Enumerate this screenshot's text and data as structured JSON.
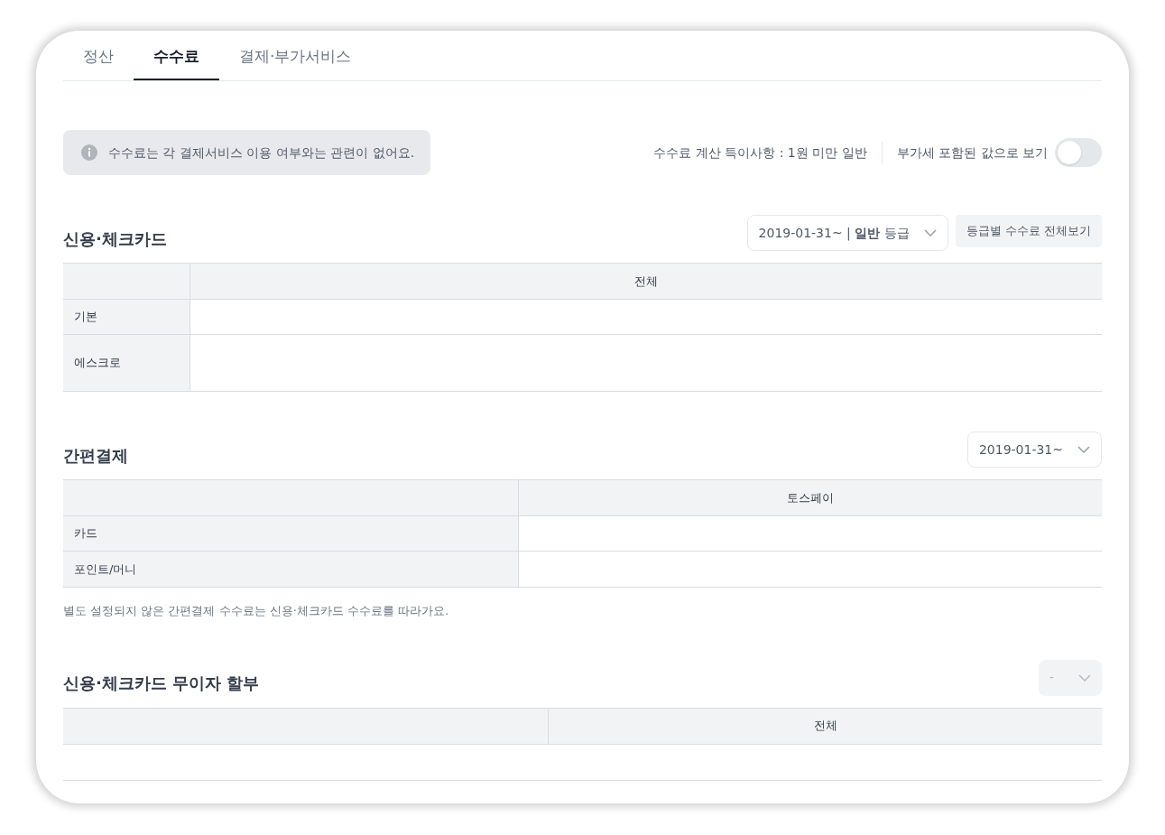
{
  "tabs": [
    {
      "label": "정산",
      "selected": false
    },
    {
      "label": "수수료",
      "selected": true
    },
    {
      "label": "결제·부가서비스",
      "selected": false
    }
  ],
  "info_notice": "수수료는 각 결제서비스 이용 여부와는 관련이 없어요.",
  "fee_note": "수수료 계산 특이사항 : 1원 미만 일반",
  "vat_toggle": {
    "label": "부가세 포함된 값으로 보기",
    "on": false
  },
  "sections": [
    {
      "title": "신용·체크카드",
      "select": {
        "value": "2019-01-31~ | **일반** 등급",
        "disabled": false
      },
      "button": "등급별 수수료 전체보기",
      "columns": [
        "전체"
      ],
      "rows": [
        {
          "label": "기본",
          "tall": false
        },
        {
          "label": "에스크로",
          "tall": true
        }
      ]
    },
    {
      "title": "간편결제",
      "select": {
        "value": "2019-01-31~",
        "disabled": false
      },
      "columns": [
        "토스페이"
      ],
      "rows": [
        {
          "label": "카드",
          "tall": false
        },
        {
          "label": "포인트/머니",
          "tall": false
        }
      ],
      "footnote": "별도 설정되지 않은 간편결제 수수료는 신용·체크카드 수수료를 따라가요."
    },
    {
      "title": "신용·체크카드 무이자 할부",
      "select": {
        "value": "-",
        "disabled": true
      },
      "columns": [
        "전체"
      ]
    }
  ]
}
